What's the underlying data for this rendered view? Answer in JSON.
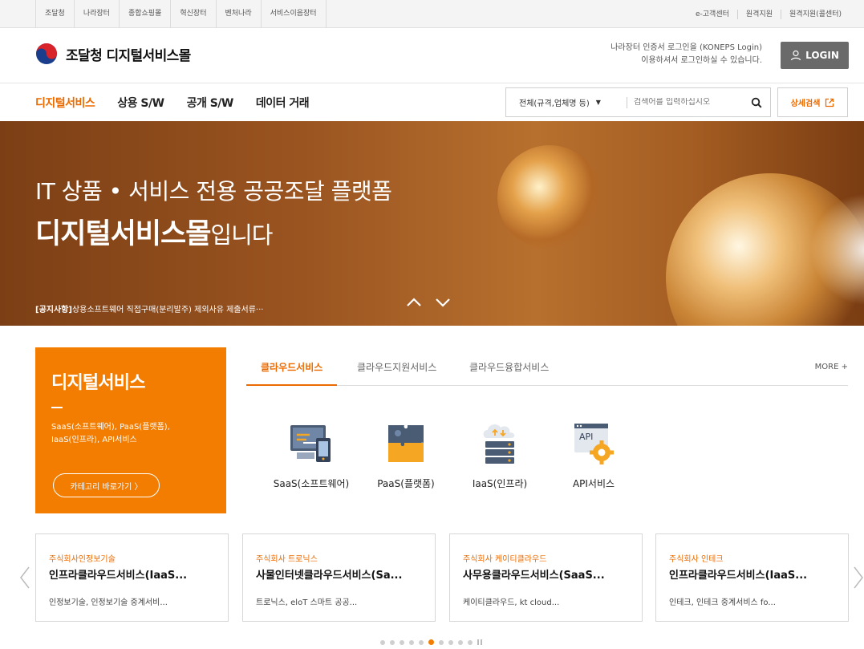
{
  "topbar": {
    "left_links": [
      "조달청",
      "나라장터",
      "종합쇼핑몰",
      "혁신장터",
      "벤처나라",
      "서비스이음장터"
    ],
    "right_links": [
      "e-고객센터",
      "원격지원",
      "원격지원(콜센터)"
    ]
  },
  "header": {
    "logo_text": "조달청 디지털서비스몰",
    "login_note_line1": "나라장터 인증서 로그인을 (KONEPS Login)",
    "login_note_line2": "이용하셔서 로그인하실 수 있습니다.",
    "login_button": "LOGIN"
  },
  "nav": {
    "menu": [
      "디지털서비스",
      "상용 S/W",
      "공개 S/W",
      "데이터 거래"
    ],
    "active_index": 0,
    "search_scope": "전체(규격,업체명 등)",
    "search_placeholder": "검색어를 입력하십시오",
    "detail_search": "상세검색"
  },
  "banner": {
    "line1": "IT 상품 • 서비스 전용 공공조달 플랫폼",
    "line2_bold": "디지털서비스몰",
    "line2_suffix": "입니다",
    "notice_tag": "[공지사항]",
    "notice_text": "상용소프트웨어 직접구매(분리발주) 제외사유 제출서류···"
  },
  "category": {
    "title": "디지털서비스",
    "desc_line1": "SaaS(소프트웨어), PaaS(플랫폼),",
    "desc_line2": "IaaS(인프라), API서비스",
    "button": "카테고리 바로가기 〉"
  },
  "tabs": {
    "items": [
      "클라우드서비스",
      "클라우드지원서비스",
      "클라우드융합서비스"
    ],
    "active_index": 0,
    "more": "MORE +"
  },
  "services": [
    {
      "label": "SaaS(소프트웨어)",
      "icon": "saas-icon"
    },
    {
      "label": "PaaS(플랫폼)",
      "icon": "paas-icon"
    },
    {
      "label": "IaaS(인프라)",
      "icon": "iaas-icon"
    },
    {
      "label": "API서비스",
      "icon": "api-icon",
      "icon_text": "API"
    }
  ],
  "cards": [
    {
      "company": "주식회사인정보기술",
      "name": "인프라클라우드서비스(IaaS...",
      "tags": "인정보기술, 인정보기술 중계서비..."
    },
    {
      "company": "주식회사 트로닉스",
      "name": "사물인터넷클라우드서비스(Sa...",
      "tags": "트로닉스, eloT 스마트 공공..."
    },
    {
      "company": "주식회사 케이티클라우드",
      "name": "사무용클라우드서비스(SaaS...",
      "tags": "케이티클라우드, kt cloud..."
    },
    {
      "company": "주식회사 인테크",
      "name": "인프라클라우드서비스(IaaS...",
      "tags": "인테크, 인테크 중계서비스 fo..."
    }
  ],
  "pagination": {
    "total": 10,
    "active": 5
  },
  "colors": {
    "accent": "#ec6b00",
    "category_bg": "#f27d00",
    "login_bg": "#6a6a6a"
  }
}
